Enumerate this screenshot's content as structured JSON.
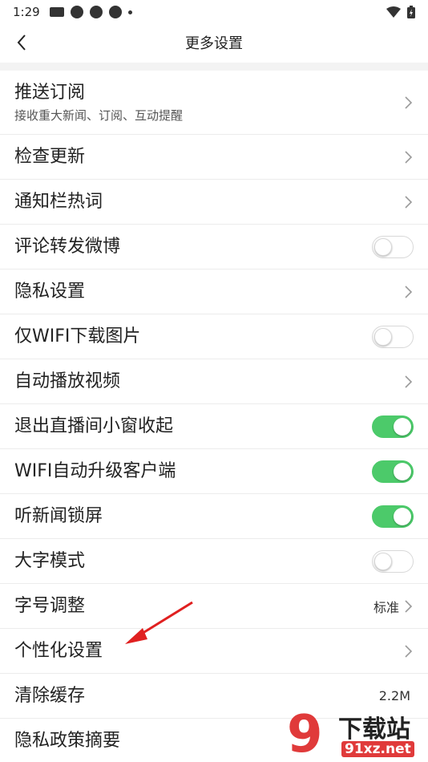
{
  "status_bar": {
    "time": "1:29"
  },
  "header": {
    "title": "更多设置"
  },
  "colors": {
    "toggle_on": "#4cca6a",
    "annotation_arrow": "#e02020",
    "watermark": "#e03a3a"
  },
  "settings": [
    {
      "label": "推送订阅",
      "sub": "接收重大新闻、订阅、互动提醒",
      "control": "chevron"
    },
    {
      "label": "检查更新",
      "control": "chevron"
    },
    {
      "label": "通知栏热词",
      "control": "chevron"
    },
    {
      "label": "评论转发微博",
      "control": "toggle",
      "on": false
    },
    {
      "label": "隐私设置",
      "control": "chevron"
    },
    {
      "label": "仅WIFI下载图片",
      "control": "toggle",
      "on": false
    },
    {
      "label": "自动播放视频",
      "control": "chevron"
    },
    {
      "label": "退出直播间小窗收起",
      "control": "toggle",
      "on": true
    },
    {
      "label": "WIFI自动升级客户端",
      "control": "toggle",
      "on": true
    },
    {
      "label": "听新闻锁屏",
      "control": "toggle",
      "on": true
    },
    {
      "label": "大字模式",
      "control": "toggle",
      "on": false
    },
    {
      "label": "字号调整",
      "value": "标准",
      "control": "chevron"
    },
    {
      "label": "个性化设置",
      "control": "chevron"
    },
    {
      "label": "清除缓存",
      "value": "2.2M"
    },
    {
      "label": "隐私政策摘要"
    }
  ],
  "watermark": {
    "logo_char": "9",
    "text": "下载站",
    "domain": "91xz.net"
  }
}
